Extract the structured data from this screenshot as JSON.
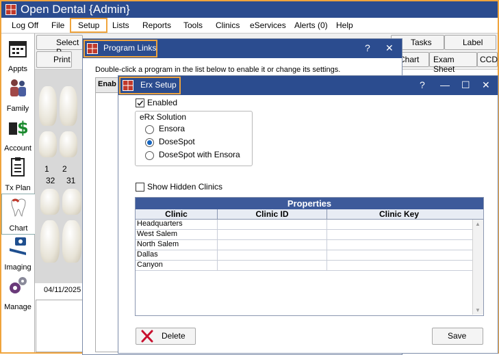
{
  "app": {
    "title": "Open Dental {Admin}"
  },
  "menu": [
    "Log Off",
    "File",
    "Setup",
    "Lists",
    "Reports",
    "Tools",
    "Clinics",
    "eServices",
    "Alerts (0)",
    "Help"
  ],
  "modules": [
    "Appts",
    "Family",
    "Account",
    "Tx Plan",
    "Chart",
    "Imaging",
    "Manage"
  ],
  "background": {
    "select_patient": "Select P",
    "print": "Print",
    "tasks": "Tasks",
    "label": "Label",
    "chart_btn": "Chart",
    "exam_sheet": "Exam Sheet",
    "ccd": "CCD",
    "tooth_nums_upper": [
      "1",
      "2"
    ],
    "tooth_nums_lower": [
      "32",
      "31"
    ],
    "date": "04/11/2025"
  },
  "program_links": {
    "title": "Program Links",
    "help": "?",
    "close": "✕",
    "instructions": "Double-click a program in the list below to enable it or change its settings.",
    "col_enabled": "Enab"
  },
  "erx": {
    "title": "Erx Setup",
    "help": "?",
    "minimize": "—",
    "maximize": "☐",
    "close": "✕",
    "enabled_label": "Enabled",
    "enabled_checked": true,
    "group_label": "eRx Solution",
    "options": [
      "Ensora",
      "DoseSpot",
      "DoseSpot with Ensora"
    ],
    "selected": "DoseSpot",
    "show_hidden_label": "Show Hidden Clinics",
    "grid_title": "Properties",
    "columns": [
      "Clinic",
      "Clinic ID",
      "Clinic Key"
    ],
    "rows": [
      "Headquarters",
      "West Salem",
      "North Salem",
      "Dallas",
      "Canyon"
    ],
    "delete_label": "Delete",
    "save_label": "Save"
  },
  "colors": {
    "titlebar": "#2b4c8f",
    "highlight": "#f0a43c",
    "grid_header": "#3d5a9a"
  },
  "icons": [
    "app-icon",
    "appointments-icon",
    "family-icon",
    "account-dollar-icon",
    "tx-plan-clipboard-icon",
    "chart-tooth-icon",
    "imaging-camera-icon",
    "manage-gears-icon",
    "delete-x-icon",
    "checkmark-icon"
  ]
}
